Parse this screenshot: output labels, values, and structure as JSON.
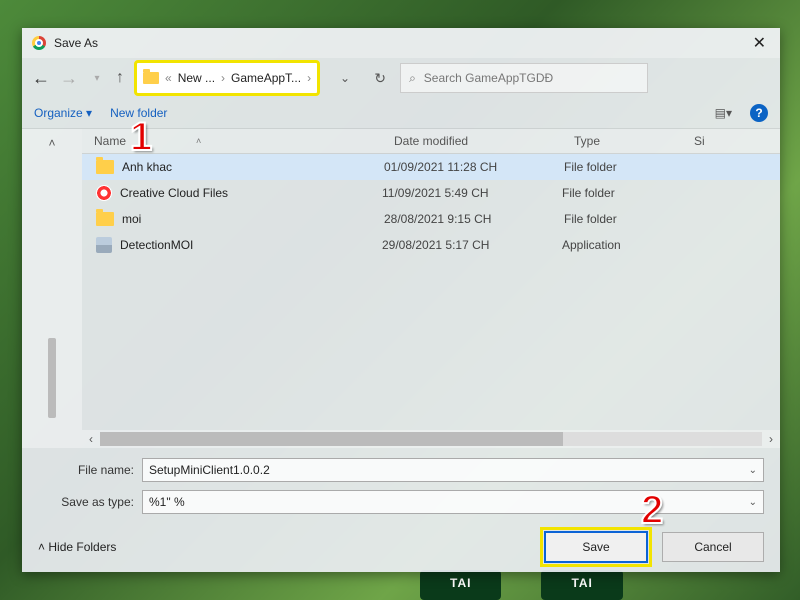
{
  "title": "Save As",
  "breadcrumb": {
    "sep_left": "«",
    "part1": "New ...",
    "part2": "GameAppT...",
    "caret": "›"
  },
  "search": {
    "placeholder": "Search GameAppTGDĐ"
  },
  "cmdbar": {
    "organize": "Organize ▾",
    "newfolder": "New folder",
    "view_caret": "▾"
  },
  "headers": {
    "name": "Name",
    "date": "Date modified",
    "type": "Type",
    "size": "Si"
  },
  "rows": [
    {
      "icon": "folder",
      "name": "Anh khac",
      "date": "01/09/2021 11:28 CH",
      "type": "File folder",
      "sel": true
    },
    {
      "icon": "cc",
      "name": "Creative Cloud Files",
      "date": "11/09/2021 5:49 CH",
      "type": "File folder",
      "sel": false
    },
    {
      "icon": "folder",
      "name": "moi",
      "date": "28/08/2021 9:15 CH",
      "type": "File folder",
      "sel": false
    },
    {
      "icon": "app",
      "name": "DetectionMOI",
      "date": "29/08/2021 5:17 CH",
      "type": "Application",
      "sel": false
    }
  ],
  "filename": {
    "label": "File name:",
    "value": "SetupMiniClient1.0.0.2"
  },
  "savetype": {
    "label": "Save as type:",
    "value": "%1\" %"
  },
  "hidefolders": "Hide Folders",
  "buttons": {
    "save": "Save",
    "cancel": "Cancel"
  },
  "callouts": {
    "one": "1",
    "two": "2"
  },
  "bg_btn": "TAI"
}
